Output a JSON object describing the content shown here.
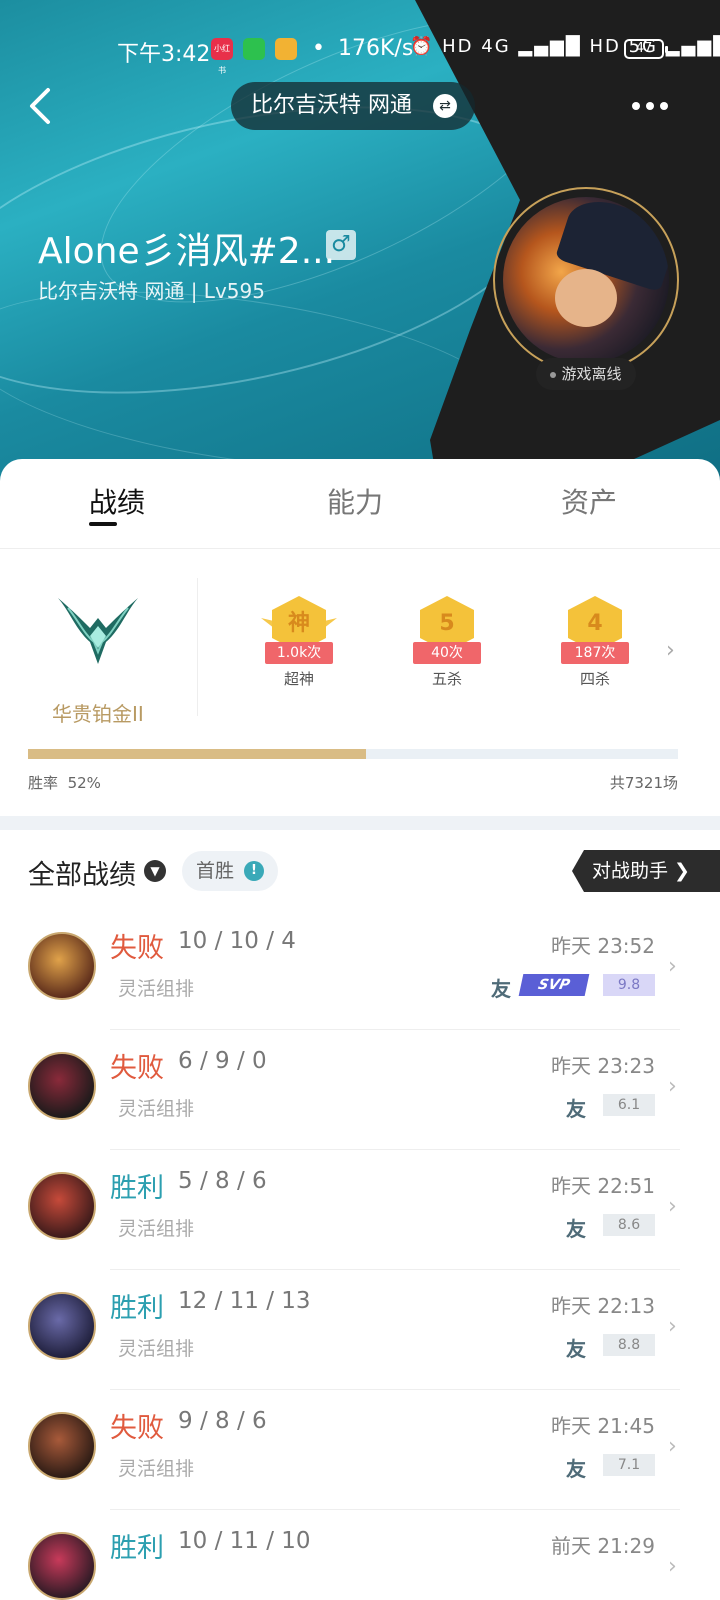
{
  "status_bar": {
    "time": "下午3:42",
    "app_badge": "小红书",
    "net_speed": "176K/s",
    "network_icons": "⏰ HD 4G ▂▄▆█ HD 5G ▂▄▆█",
    "battery": "47"
  },
  "header": {
    "server_label": "比尔吉沃特 网通",
    "swap_icon": "⇄",
    "player_name": "Alone彡消风#2...",
    "gender_icon": "♂",
    "player_sub": "比尔吉沃特 网通 | Lv595",
    "online_status": "游戏离线"
  },
  "tabs": [
    {
      "label": "战绩"
    },
    {
      "label": "能力"
    },
    {
      "label": "资产"
    }
  ],
  "rank": {
    "name": "华贵铂金II"
  },
  "medals": [
    {
      "glyph": "神",
      "count": "1.0k次",
      "label": "超神"
    },
    {
      "glyph": "5",
      "count": "40次",
      "label": "五杀"
    },
    {
      "glyph": "4",
      "count": "187次",
      "label": "四杀"
    }
  ],
  "summary": {
    "win_rate_label": "胜率",
    "win_rate": "52%",
    "win_rate_value": 0.52,
    "total_games": "共7321场"
  },
  "filter": {
    "title": "全部战绩",
    "chip": "首胜",
    "chip_info": "!",
    "assistant": "对战助手 ❯"
  },
  "matches": [
    {
      "result": "失败",
      "outcome": "loss",
      "kda": "10 / 10 / 4",
      "mode": "灵活组排",
      "time": "昨天 23:52",
      "friend": "友",
      "svp": "SVP",
      "score": "9.8"
    },
    {
      "result": "失败",
      "outcome": "loss",
      "kda": "6 / 9 / 0",
      "mode": "灵活组排",
      "time": "昨天 23:23",
      "friend": "友",
      "score": "6.1"
    },
    {
      "result": "胜利",
      "outcome": "win",
      "kda": "5 / 8 / 6",
      "mode": "灵活组排",
      "time": "昨天 22:51",
      "friend": "友",
      "score": "8.6"
    },
    {
      "result": "胜利",
      "outcome": "win",
      "kda": "12 / 11 / 13",
      "mode": "灵活组排",
      "time": "昨天 22:13",
      "friend": "友",
      "score": "8.8"
    },
    {
      "result": "失败",
      "outcome": "loss",
      "kda": "9 / 8 / 6",
      "mode": "灵活组排",
      "time": "昨天 21:45",
      "friend": "友",
      "score": "7.1"
    },
    {
      "result": "胜利",
      "outcome": "win",
      "kda": "10 / 11 / 10",
      "mode": "",
      "time": "前天 21:29",
      "friend": "",
      "score": ""
    }
  ],
  "colors": {
    "win": "#2c9fb0",
    "loss": "#e05a3e",
    "rank_gold": "#b89a63"
  }
}
